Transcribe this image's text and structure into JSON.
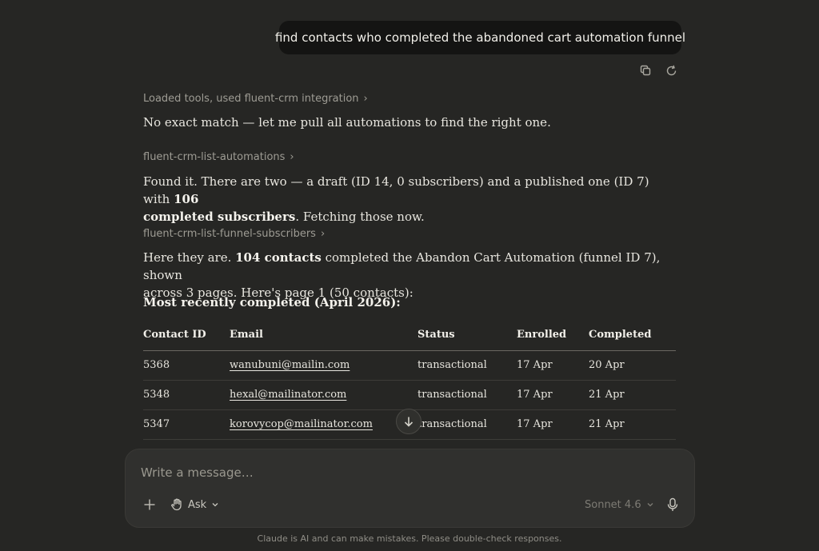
{
  "user_message": "find contacts who completed the abandoned cart automation funnel",
  "assistant": {
    "tool_1": "Loaded tools, used fluent-crm integration",
    "text_1": "No exact match — let me pull all automations to find the right one.",
    "tool_2": "fluent-crm-list-automations",
    "text_2_a": "Found it. There are two — a draft (ID 14, 0 subscribers) and a published one (ID 7) with ",
    "text_2_b": "106",
    "text_2_c": "completed subscribers",
    "text_2_d": ". Fetching those now.",
    "tool_3": "fluent-crm-list-funnel-subscribers",
    "text_3_a": "Here they are. ",
    "text_3_b": "104 contacts",
    "text_3_c": " completed the Abandon Cart Automation (funnel ID 7), shown",
    "text_3_d": "across 3 pages. Here's page 1 (50 contacts):",
    "heading": "Most recently completed (April 2026):",
    "table": {
      "headers": [
        "Contact ID",
        "Email",
        "Status",
        "Enrolled",
        "Completed"
      ],
      "rows": [
        {
          "id": "5368",
          "email": "wanubuni@mailin.com",
          "status": "transactional",
          "enrolled": "17 Apr",
          "completed": "20 Apr"
        },
        {
          "id": "5348",
          "email": "hexal@mailinator.com",
          "status": "transactional",
          "enrolled": "17 Apr",
          "completed": "21 Apr"
        },
        {
          "id": "5347",
          "email": "korovycop@mailinator.com",
          "status": "transactional",
          "enrolled": "17 Apr",
          "completed": "21 Apr"
        }
      ]
    }
  },
  "composer": {
    "placeholder": "Write a message…",
    "ask_label": "Ask",
    "model_label": "Sonnet 4.6"
  },
  "disclaimer": "Claude is AI and can make mistakes. Please double-check responses.",
  "icons": {
    "copy": "copy-icon",
    "retry": "retry-icon",
    "chevron": "chevron-right-icon",
    "scroll": "arrow-down-icon",
    "plus": "plus-icon",
    "hand": "hand-icon",
    "mic": "microphone-icon"
  }
}
